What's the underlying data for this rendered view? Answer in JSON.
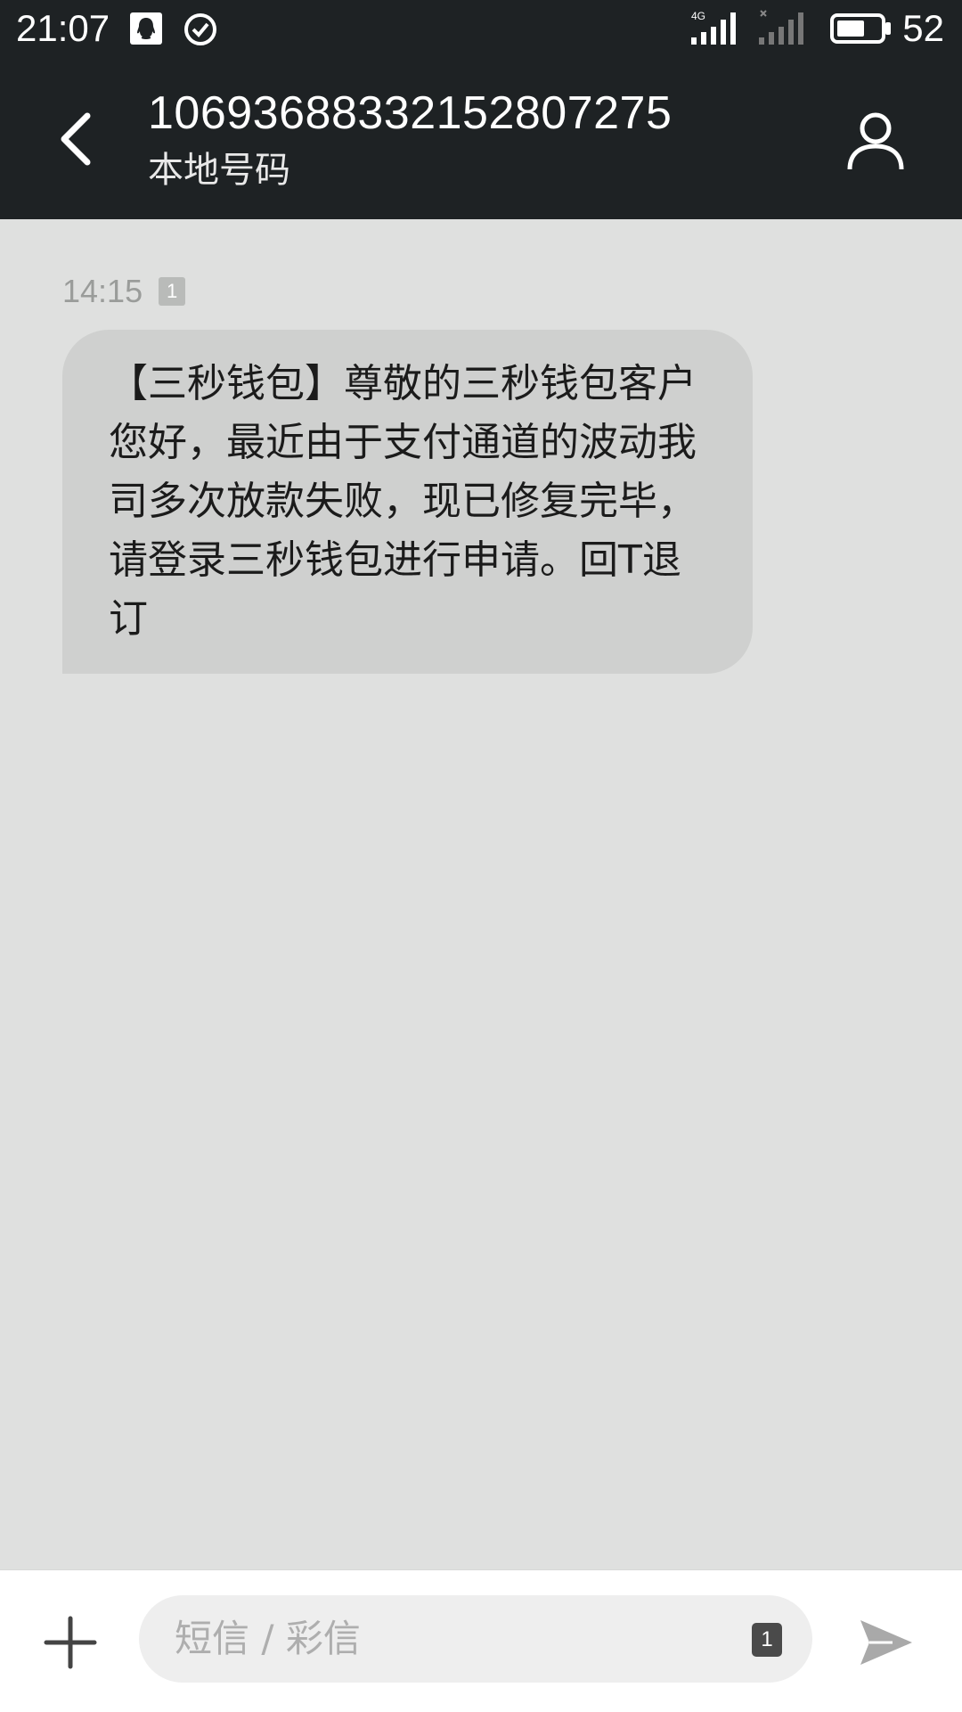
{
  "status_bar": {
    "time": "21:07",
    "network_label": "4G",
    "battery_percent": "52",
    "icons": [
      "qq-icon",
      "check-circle-icon",
      "signal-4g-icon",
      "signal-no-sim-icon",
      "battery-icon"
    ]
  },
  "header": {
    "title": "1069368833215280727​5",
    "subtitle": "本地号码"
  },
  "message": {
    "time": "14:15",
    "sim_slot": "1",
    "text": "【三秒钱包】尊敬的三秒钱包客户您好，最近由于支付通道的波动我司多次放款失败，现已修复完毕，请登录三秒钱包进行申请。回T退订"
  },
  "composer": {
    "placeholder": "短信 / 彩信",
    "sim_slot": "1"
  },
  "colors": {
    "header_bg": "#1e2224",
    "conversation_bg": "#dfe0df",
    "bubble_bg": "#cfd0cf"
  }
}
